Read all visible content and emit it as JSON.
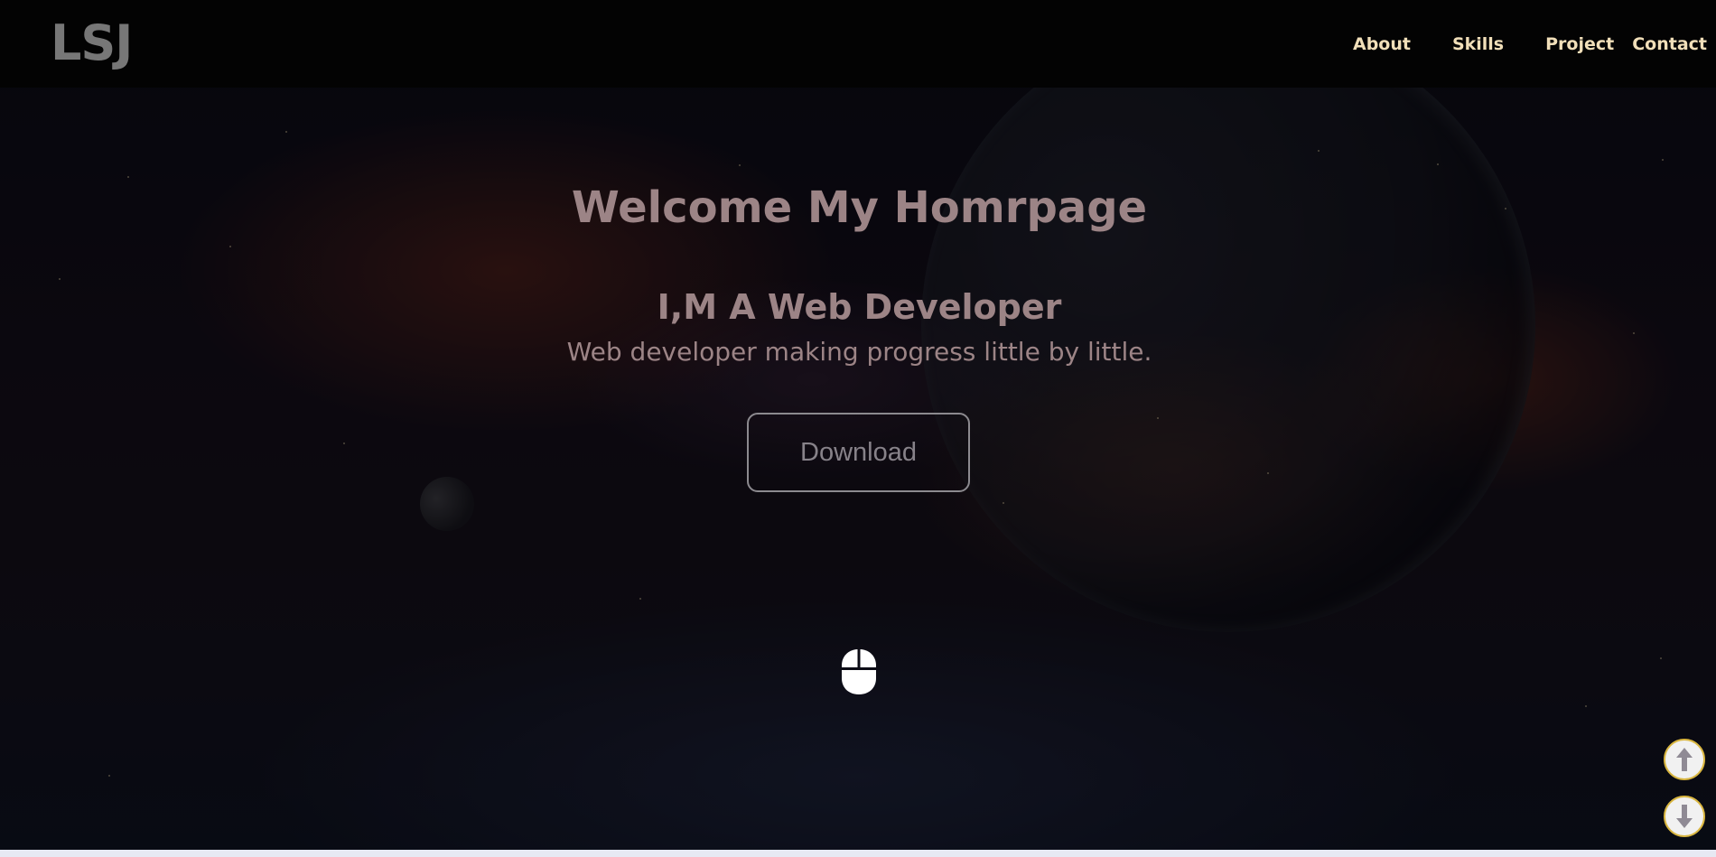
{
  "header": {
    "logo": "LSJ",
    "nav": [
      {
        "label": "About"
      },
      {
        "label": "Skills"
      },
      {
        "label": "Project"
      },
      {
        "label": "Contact"
      }
    ]
  },
  "hero": {
    "title": "Welcome My Homrpage",
    "subtitle": "I,M A Web Developer",
    "description": "Web developer making progress little by little.",
    "download_label": "Download",
    "scroll_hint_icon": "mouse-icon"
  },
  "scroll_controls": {
    "up_icon": "arrow-up-icon",
    "down_icon": "arrow-down-icon",
    "border_color": "#d9b640"
  },
  "colors": {
    "header_bg": "#030303",
    "logo": "#777777",
    "nav_text": "#f1dfb9",
    "hero_text": "#9c8486",
    "button_text": "#878289"
  }
}
